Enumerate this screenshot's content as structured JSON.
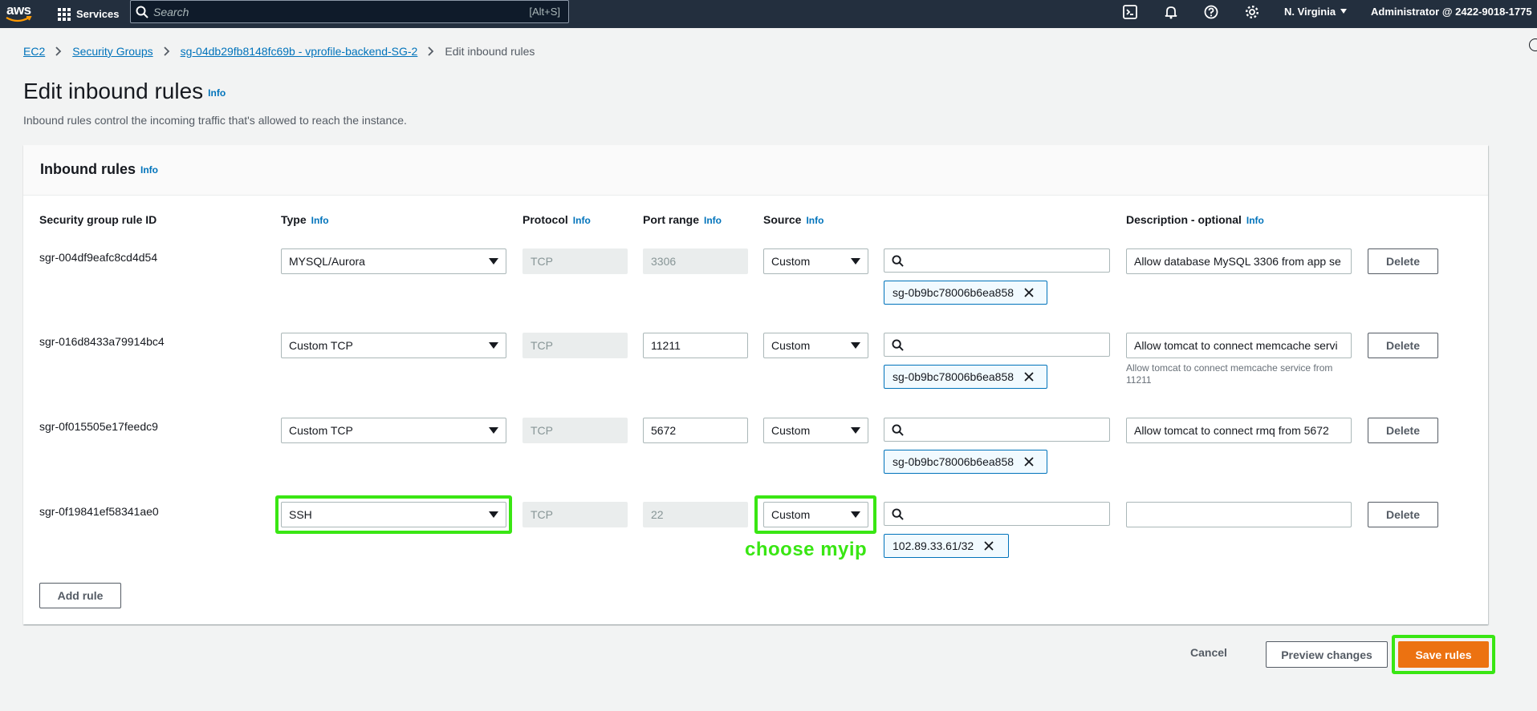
{
  "topnav": {
    "logo_text": "aws",
    "services_label": "Services",
    "search_placeholder": "Search",
    "search_shortcut": "[Alt+S]",
    "region": "N. Virginia",
    "account": "Administrator @ 2422-9018-1775"
  },
  "breadcrumb": {
    "items": [
      "EC2",
      "Security Groups",
      "sg-04db29fb8148fc69b - vprofile-backend-SG-2"
    ],
    "current": "Edit inbound rules"
  },
  "page": {
    "title": "Edit inbound rules",
    "info": "Info",
    "subtitle": "Inbound rules control the incoming traffic that's allowed to reach the instance."
  },
  "panel": {
    "title": "Inbound rules",
    "columns": {
      "rule_id": "Security group rule ID",
      "type": "Type",
      "protocol": "Protocol",
      "port_range": "Port range",
      "source": "Source",
      "description": "Description - optional"
    },
    "rules": [
      {
        "id": "sgr-004df9eafc8cd4d54",
        "type": "MYSQL/Aurora",
        "protocol": "TCP",
        "port": "3306",
        "source": "Custom",
        "token": "sg-0b9bc78006b6ea858",
        "description": "Allow database MySQL 3306 from app se",
        "delete": "Delete"
      },
      {
        "id": "sgr-016d8433a79914bc4",
        "type": "Custom TCP",
        "protocol": "TCP",
        "port": "11211",
        "source": "Custom",
        "token": "sg-0b9bc78006b6ea858",
        "description": "Allow tomcat to connect memcache servi",
        "hint": "Allow tomcat to connect memcache service from 11211",
        "delete": "Delete"
      },
      {
        "id": "sgr-0f015505e17feedc9",
        "type": "Custom TCP",
        "protocol": "TCP",
        "port": "5672",
        "source": "Custom",
        "token": "sg-0b9bc78006b6ea858",
        "description": "Allow tomcat to connect rmq from 5672",
        "delete": "Delete"
      },
      {
        "id": "sgr-0f19841ef58341ae0",
        "type": "SSH",
        "protocol": "TCP",
        "port": "22",
        "source": "Custom",
        "token": "102.89.33.61/32",
        "description": "",
        "delete": "Delete"
      }
    ],
    "add_rule": "Add rule"
  },
  "annotation": "choose myip",
  "footer": {
    "cancel": "Cancel",
    "preview": "Preview changes",
    "save": "Save rules"
  },
  "colors": {
    "nav_bg": "#232f3e",
    "link": "#0073bb",
    "primary": "#ec7211",
    "highlight": "#39e613"
  }
}
